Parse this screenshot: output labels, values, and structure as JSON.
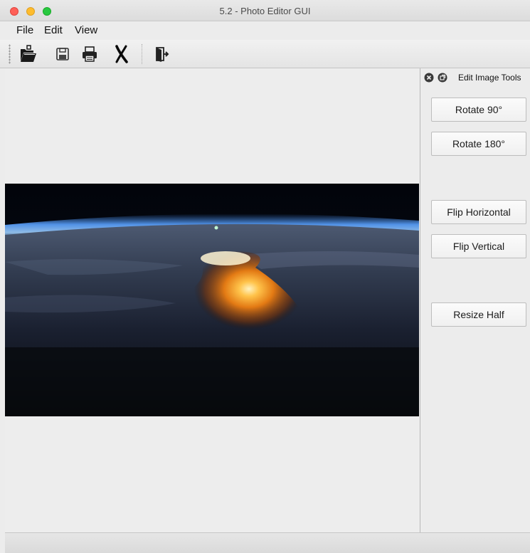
{
  "window": {
    "title": "5.2 - Photo Editor GUI"
  },
  "menu": {
    "items": [
      "File",
      "Edit",
      "View"
    ]
  },
  "toolbar": {
    "icons": [
      "open-folder-icon",
      "save-icon",
      "print-icon",
      "clear-icon",
      "exit-icon"
    ]
  },
  "dock": {
    "title": "Edit Image Tools",
    "buttons": [
      "Rotate 90°",
      "Rotate 180°",
      "Flip Horizontal",
      "Flip Vertical",
      "Resize Half"
    ]
  },
  "colors": {
    "close": "#fe5f57",
    "minimize": "#febc2e",
    "zoom": "#28c840"
  }
}
